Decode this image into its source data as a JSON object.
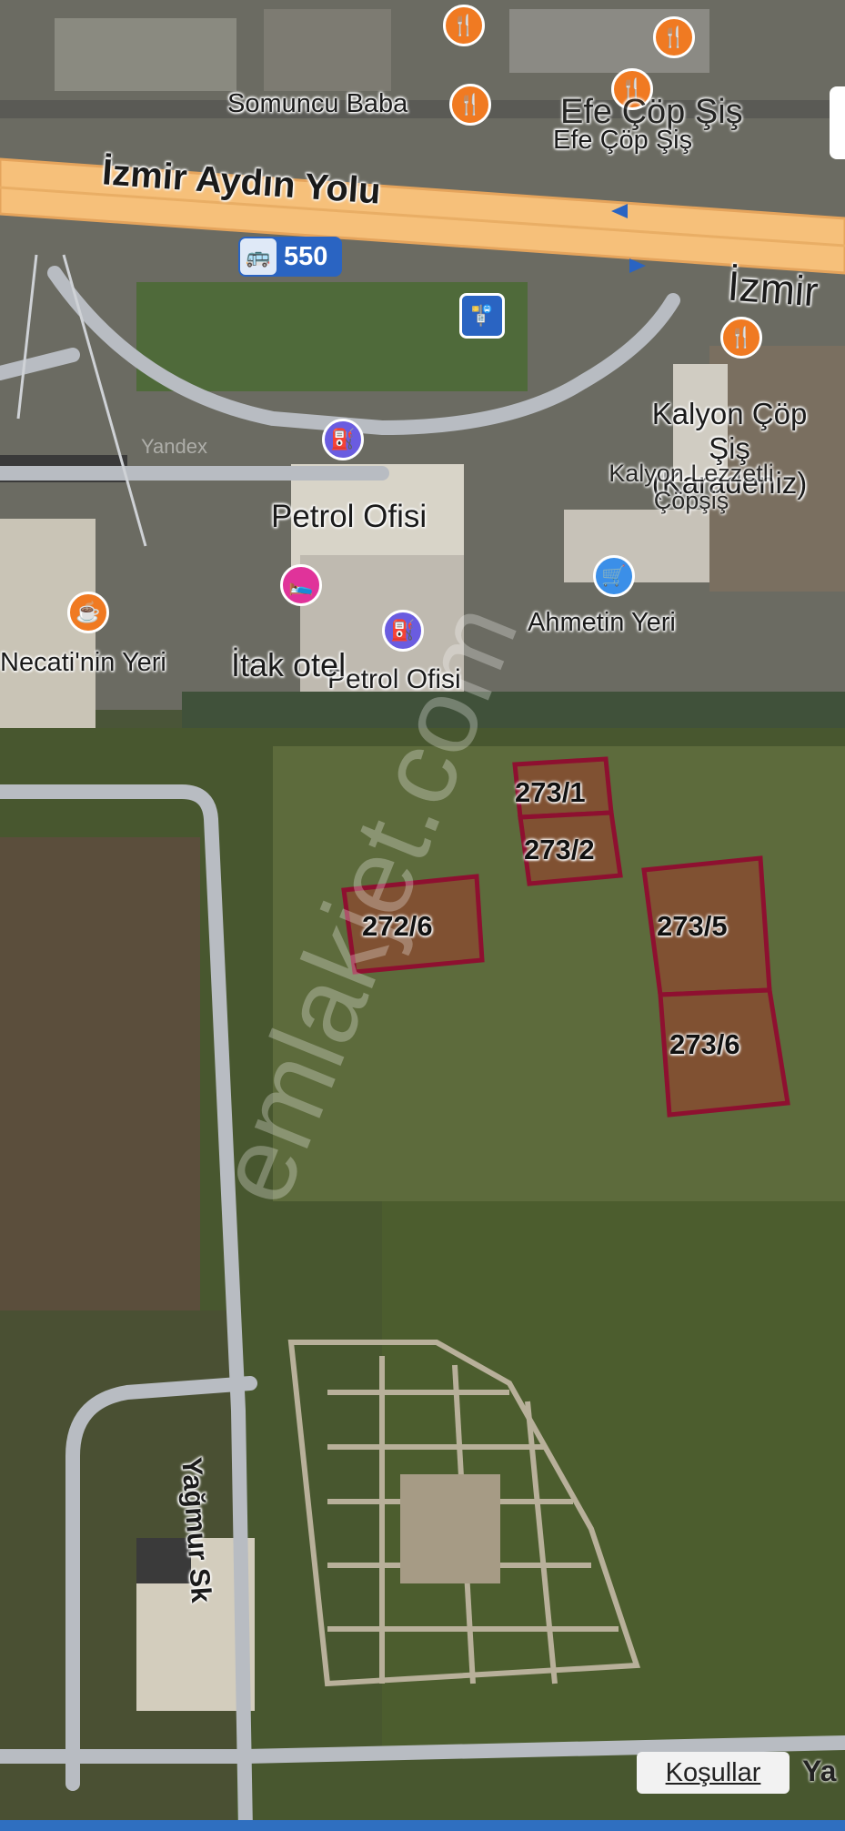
{
  "map": {
    "road_main": "İzmir Aydın Yolu",
    "road_main_right": "İzmir",
    "bus_route": "550",
    "street_side": "Yağmur Sk",
    "provider_faint": "Yandex",
    "watermark": "emlakjet.com"
  },
  "pois": [
    {
      "name": "Somuncu Baba",
      "category": "food-icon"
    },
    {
      "name": "Efe Çöp Şiş",
      "category": "food-icon"
    },
    {
      "name": "Efe Çöp Şiş",
      "category": "food-icon"
    },
    {
      "name": "Kalyon Çöp Şiş (Karadeniz)",
      "category": "food-icon"
    },
    {
      "name": "Kalyon Lezzetli Çöpşiş",
      "category": "food-icon"
    },
    {
      "name": "Petrol Ofisi",
      "category": "fuel-icon"
    },
    {
      "name": "Petrol Ofisi",
      "category": "fuel-icon"
    },
    {
      "name": "İtak otel",
      "category": "hotel-icon"
    },
    {
      "name": "Necati'nin Yeri",
      "category": "cafe-icon"
    },
    {
      "name": "Ahmetin Yeri",
      "category": "shop-icon"
    }
  ],
  "parcels": [
    {
      "id": "273/1"
    },
    {
      "id": "273/2"
    },
    {
      "id": "272/6"
    },
    {
      "id": "273/5"
    },
    {
      "id": "273/6"
    }
  ],
  "footer": {
    "terms_label": "Koşullar",
    "provider_partial": "Ya"
  },
  "colors": {
    "road_main": "#f6c07a",
    "parcel_stroke": "#8e1030",
    "parcel_fill": "#8a4a30",
    "food_pin": "#f07a22",
    "fuel_pin": "#6a5ce0",
    "hotel_pin": "#e0339a",
    "shop_pin": "#3b8fe8",
    "transit": "#2a64c2"
  }
}
